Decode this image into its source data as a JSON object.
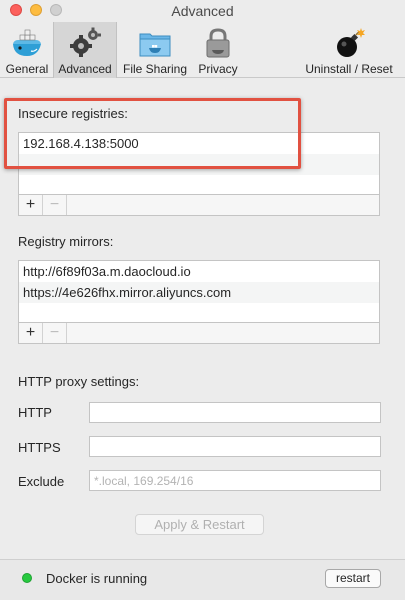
{
  "window": {
    "title": "Advanced"
  },
  "toolbar": {
    "items": [
      {
        "label": "General",
        "icon": "docker-whale-icon"
      },
      {
        "label": "Advanced",
        "icon": "gears-icon",
        "active": true
      },
      {
        "label": "File Sharing",
        "icon": "folder-icon"
      },
      {
        "label": "Privacy",
        "icon": "lock-icon"
      },
      {
        "label": "Uninstall / Reset",
        "icon": "bomb-icon"
      }
    ]
  },
  "insecure_registries": {
    "label": "Insecure registries:",
    "items": [
      "192.168.4.138:5000"
    ]
  },
  "registry_mirrors": {
    "label": "Registry mirrors:",
    "items": [
      "http://6f89f03a.m.daocloud.io",
      "https://4e626fhx.mirror.aliyuncs.com"
    ]
  },
  "list_controls": {
    "add": "+",
    "remove": "−"
  },
  "proxy": {
    "label": "HTTP proxy settings:",
    "http_label": "HTTP",
    "http_value": "",
    "https_label": "HTTPS",
    "https_value": "",
    "exclude_label": "Exclude",
    "exclude_placeholder": "*.local, 169.254/16"
  },
  "apply_button": "Apply & Restart",
  "status": {
    "text": "Docker is running",
    "color": "#27c93f"
  },
  "restart_button": "restart",
  "colors": {
    "highlight": "#e15141",
    "window_bg": "#ececec"
  }
}
